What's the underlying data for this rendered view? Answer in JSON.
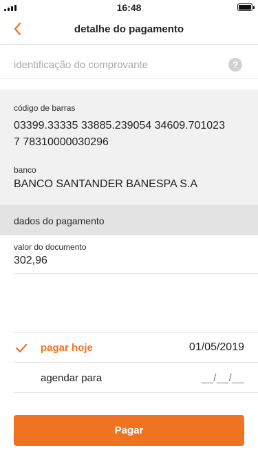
{
  "status_bar": {
    "time": "16:48"
  },
  "header": {
    "title": "detalhe do pagamento"
  },
  "receipt_id": {
    "placeholder": "identificação do comprovante"
  },
  "barcode": {
    "label": "código de barras",
    "line1": "03399.33335 33885.239054 34609.701023",
    "line2": "7 78310000030296"
  },
  "bank": {
    "label": "banco",
    "value": "BANCO SANTANDER BANESPA S.A"
  },
  "payment_data": {
    "section_title": "dados do pagamento",
    "amount_label": "valor do documento",
    "amount_value": "302,96"
  },
  "schedule": {
    "pay_today_label": "pagar hoje",
    "pay_today_date": "01/05/2019",
    "schedule_label": "agendar para",
    "schedule_date_placeholder": "__/__/__"
  },
  "actions": {
    "pay_button": "Pagar"
  },
  "colors": {
    "accent": "#f07322",
    "section_bg": "#f1f1f1",
    "band_bg": "#e3e3e3"
  }
}
